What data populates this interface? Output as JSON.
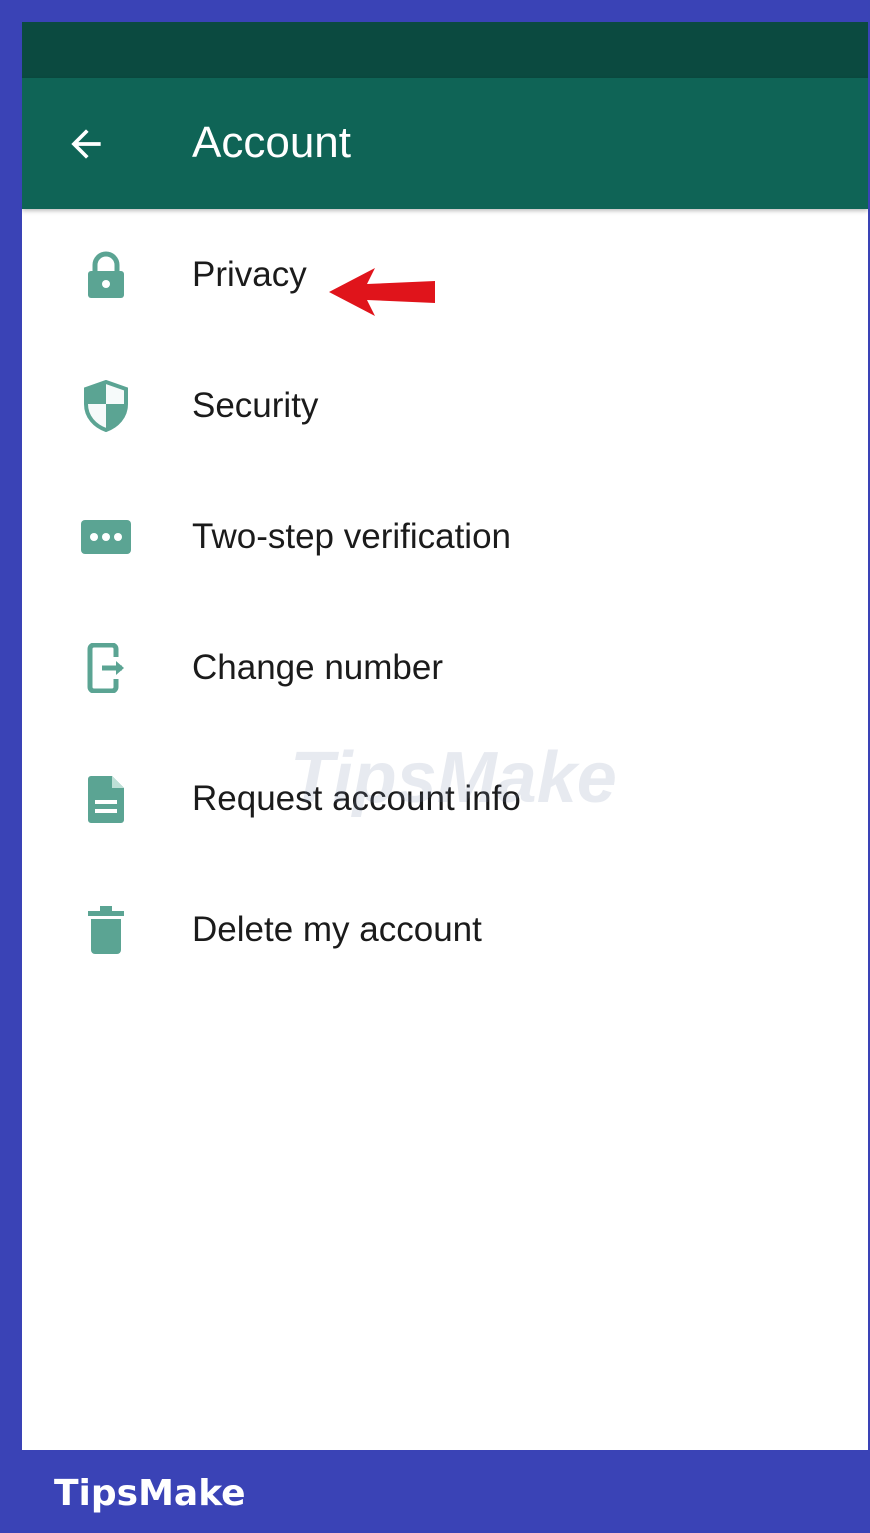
{
  "appbar": {
    "title": "Account"
  },
  "menu": {
    "items": [
      {
        "label": "Privacy",
        "icon": "lock-icon"
      },
      {
        "label": "Security",
        "icon": "shield-icon"
      },
      {
        "label": "Two-step verification",
        "icon": "password-dots-icon"
      },
      {
        "label": "Change number",
        "icon": "change-number-icon"
      },
      {
        "label": "Request account info",
        "icon": "document-icon"
      },
      {
        "label": "Delete my account",
        "icon": "trash-icon"
      }
    ]
  },
  "watermark": {
    "text": "TipsMake"
  },
  "footer": {
    "brand": "TipsMake"
  },
  "colors": {
    "frame": "#3a43b6",
    "status_bar": "#0b4a40",
    "app_bar": "#0f6456",
    "icon": "#5ba493",
    "annotation_arrow": "#e0141b"
  }
}
